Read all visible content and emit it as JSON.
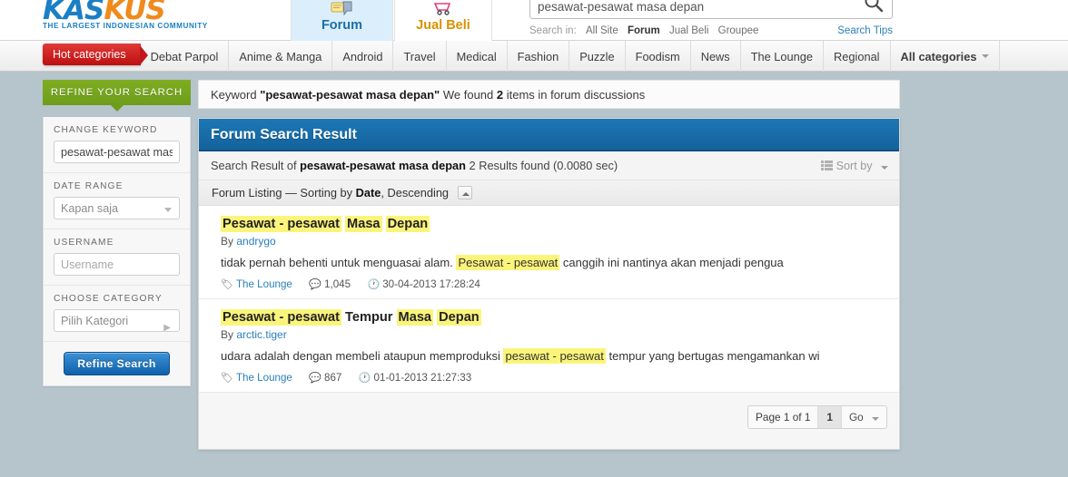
{
  "header": {
    "logo_main_blue": "KAS",
    "logo_main_orange": "KUS",
    "logo_tagline": "THE LARGEST INDONESIAN COMMUNITY",
    "tabs": [
      {
        "label": "Forum",
        "icon": "forum-icon",
        "active": true
      },
      {
        "label": "Jual Beli",
        "icon": "cart-icon",
        "active": false
      }
    ],
    "search": {
      "value": "pesawat-pesawat masa depan",
      "placeholder": "pesawat-pesawat masa depan",
      "icon": "search-icon",
      "search_in_label": "Search in:",
      "scopes": [
        "All Site",
        "Forum",
        "Jual Beli",
        "Groupee"
      ],
      "selected_scope": "Forum",
      "tips_label": "Search Tips"
    }
  },
  "nav": {
    "hot_label": "Hot categories",
    "items": [
      "Debat Parpol",
      "Anime & Manga",
      "Android",
      "Travel",
      "Medical",
      "Fashion",
      "Puzzle",
      "Foodism",
      "News",
      "The Lounge",
      "Regional"
    ],
    "all_categories": "All categories"
  },
  "sidebar": {
    "refine_header": "REFINE YOUR SEARCH",
    "sections": [
      {
        "label": "CHANGE KEYWORD",
        "type": "input",
        "value": "pesawat-pesawat mas",
        "placeholder": ""
      },
      {
        "label": "DATE RANGE",
        "type": "select",
        "value": "Kapan saja"
      },
      {
        "label": "USERNAME",
        "type": "input",
        "value": "",
        "placeholder": "Username"
      },
      {
        "label": "CHOOSE CATEGORY",
        "type": "select-arrow",
        "value": "Pilih Kategori"
      }
    ],
    "refine_button": "Refine Search"
  },
  "main": {
    "keyword_prefix": "Keyword",
    "keyword_quoted": "\"pesawat-pesawat masa depan\"",
    "keyword_found_pre": "We found",
    "keyword_count": "2",
    "keyword_found_post": "items in forum discussions",
    "result_title": "Forum Search Result",
    "result_sub_pre": "Search Result of",
    "result_sub_keyword": "pesawat-pesawat masa depan",
    "result_sub_post": "2 Results found (0.0080 sec)",
    "sort_by_label": "Sort by",
    "sort_by_icon": "list-icon",
    "listing_pre": "Forum Listing — Sorting by",
    "listing_field": "Date",
    "listing_dir": ", Descending",
    "collapse_icon": "chevron-up-icon",
    "results": [
      {
        "title_parts": [
          {
            "text": "Pesawat - pesawat",
            "hl": true
          },
          {
            "text": " ",
            "hl": false
          },
          {
            "text": "Masa",
            "hl": true
          },
          {
            "text": " ",
            "hl": false
          },
          {
            "text": "Depan",
            "hl": true
          }
        ],
        "by_label": "By",
        "author": "andrygo",
        "snippet_parts": [
          {
            "text": "tidak pernah behenti untuk menguasai alam. ",
            "hl": false
          },
          {
            "text": "Pesawat - pesawat",
            "hl": true
          },
          {
            "text": " canggih ini nantinya akan menjadi pengua",
            "hl": false
          }
        ],
        "category": "The Lounge",
        "category_icon": "tag-icon",
        "comments": "1,045",
        "comments_icon": "comment-icon",
        "date": "30-04-2013 17:28:24",
        "date_icon": "clock-icon"
      },
      {
        "title_parts": [
          {
            "text": "Pesawat - pesawat",
            "hl": true
          },
          {
            "text": " Tempur ",
            "hl": false
          },
          {
            "text": "Masa",
            "hl": true
          },
          {
            "text": " ",
            "hl": false
          },
          {
            "text": "Depan",
            "hl": true
          }
        ],
        "by_label": "By",
        "author": "arctic.tiger",
        "snippet_parts": [
          {
            "text": "udara adalah dengan membeli ataupun memproduksi ",
            "hl": false
          },
          {
            "text": "pesawat - pesawat",
            "hl": true
          },
          {
            "text": " tempur yang bertugas mengamankan wi",
            "hl": false
          }
        ],
        "category": "The Lounge",
        "category_icon": "tag-icon",
        "comments": "867",
        "comments_icon": "comment-icon",
        "date": "01-01-2013 21:27:33",
        "date_icon": "clock-icon"
      }
    ],
    "pager": {
      "page_label": "Page 1 of 1",
      "current_page": "1",
      "go_label": "Go"
    }
  },
  "colors": {
    "page_bg": "#b6c4cc",
    "accent_blue": "#14629c",
    "accent_green": "#79a91f",
    "accent_red": "#c2161a",
    "highlight": "#fbf47a",
    "link": "#2a7fbb"
  }
}
